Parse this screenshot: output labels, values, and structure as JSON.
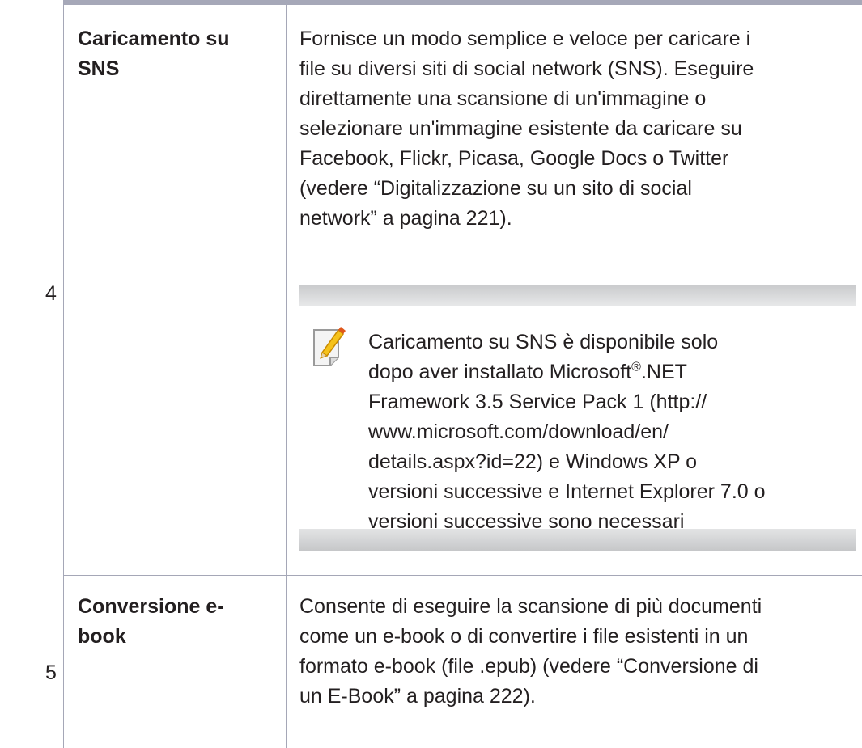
{
  "rows": [
    {
      "number": "4",
      "label_line1": "Caricamento su",
      "label_line2": "SNS",
      "description_lines": [
        "Fornisce un modo semplice e veloce per caricare i",
        "file su diversi siti di social network (SNS). Eseguire",
        "direttamente una scansione di un'immagine o",
        "selezionare un'immagine esistente da caricare su",
        "Facebook, Flickr, Picasa, Google Docs o Twitter",
        "(vedere “Digitalizzazione su un sito di social",
        "network” a pagina 221)."
      ],
      "note": {
        "line1": "Caricamento su SNS è disponibile solo",
        "line2_before": "dopo aver installato Microsoft",
        "line2_sup": "®",
        "line2_after": ".NET",
        "line3": "Framework 3.5 Service Pack 1 (http://",
        "line4": "www.microsoft.com/download/en/",
        "line5": "details.aspx?id=22) e Windows XP o",
        "line6": "versioni successive e Internet Explorer 7.0 o",
        "line7": "versioni successive sono necessari"
      }
    },
    {
      "number": "5",
      "label_line1": "Conversione e-",
      "label_line2": "book",
      "description_lines": [
        "Consente di eseguire la scansione di più documenti",
        "come un e-book o di convertire i file esistenti in un",
        "formato e-book (file .epub) (vedere “Conversione di",
        "un E-Book” a pagina 222)."
      ]
    }
  ]
}
